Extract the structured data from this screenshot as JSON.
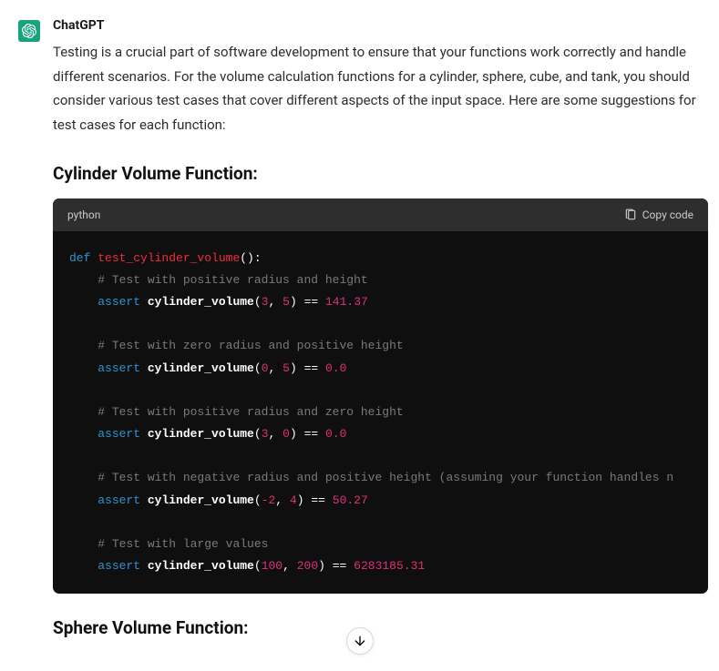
{
  "author": "ChatGPT",
  "intro": "Testing is a crucial part of software development to ensure that your functions work correctly and handle different scenarios. For the volume calculation functions for a cylinder, sphere, cube, and tank, you should consider various test cases that cover different aspects of the input space. Here are some suggestions for test cases for each function:",
  "section1": "Cylinder Volume Function:",
  "section2": "Sphere Volume Function:",
  "code": {
    "lang": "python",
    "copy_label": "Copy code",
    "kw_def": "def",
    "kw_assert": "assert",
    "fn_def_name": "test_cylinder_volume",
    "call_name": "cylinder_volume",
    "comments": {
      "c1": "# Test with positive radius and height",
      "c2": "# Test with zero radius and positive height",
      "c3": "# Test with positive radius and zero height",
      "c4": "# Test with negative radius and positive height (assuming your function handles n",
      "c5": "# Test with large values"
    },
    "args": {
      "a1a": "3",
      "a1b": "5",
      "r1": "141.37",
      "a2a": "0",
      "a2b": "5",
      "r2": "0.0",
      "a3a": "3",
      "a3b": "0",
      "r3": "0.0",
      "a4a": "-2",
      "a4b": "4",
      "r4": "50.27",
      "a5a": "100",
      "a5b": "200",
      "r5": "6283185.31"
    }
  }
}
